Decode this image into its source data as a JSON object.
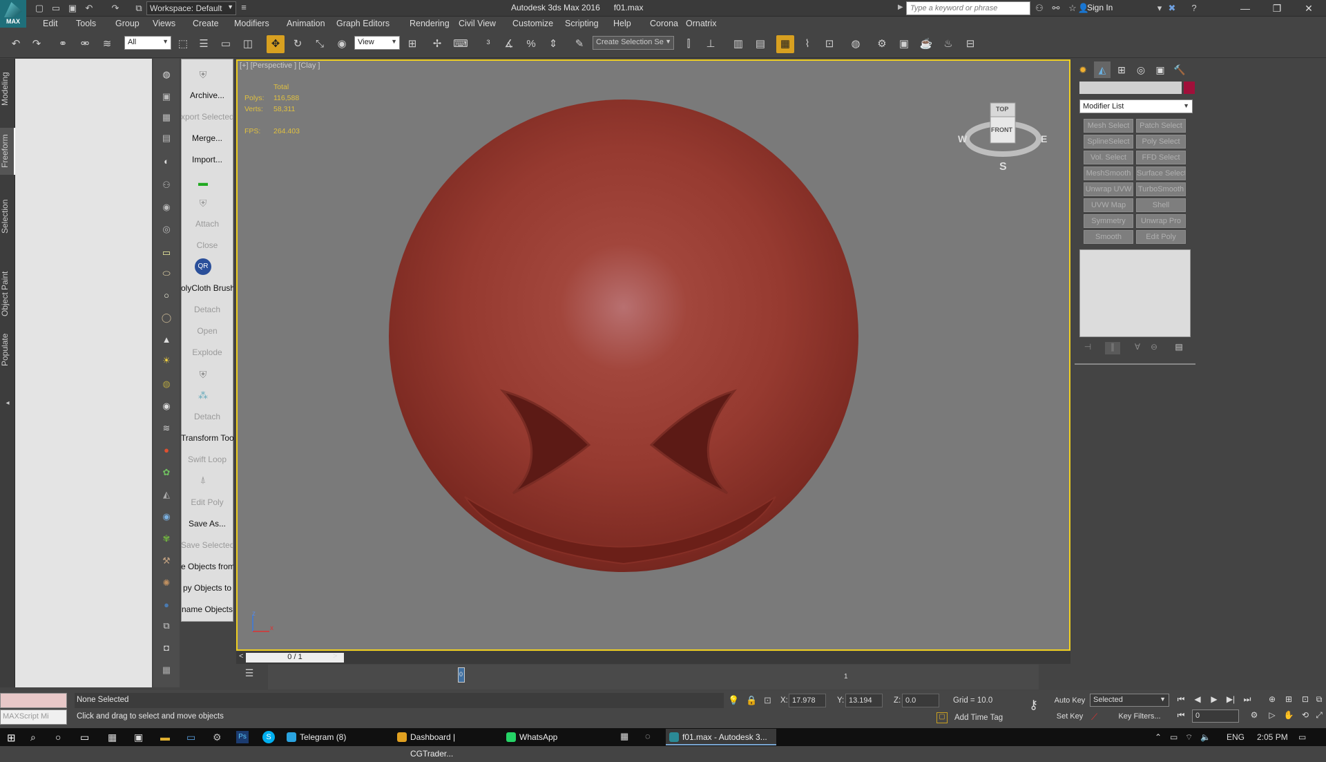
{
  "titlebar": {
    "app_logo_text": "MAX",
    "workspace": "Workspace: Default",
    "title": "Autodesk 3ds Max 2016      f01.max",
    "search_placeholder": "Type a keyword or phrase",
    "sign_in": "Sign In"
  },
  "menu": [
    "Edit",
    "Tools",
    "Group",
    "Views",
    "Create",
    "Modifiers",
    "Animation",
    "Graph Editors",
    "Rendering",
    "Civil View",
    "Customize",
    "Scripting",
    "Help",
    "Corona",
    "Ornatrix"
  ],
  "toolbar": {
    "filter_value": "All",
    "refcoord_value": "View",
    "selection_set_placeholder": "Create Selection Se"
  },
  "ribbon_tabs": [
    "Modeling",
    "Freeform",
    "Selection",
    "Object Paint",
    "Populate"
  ],
  "command_column": [
    {
      "label": "Archive...",
      "dim": false
    },
    {
      "label": "xport Selected",
      "dim": true
    },
    {
      "label": "Merge...",
      "dim": false
    },
    {
      "label": "Import...",
      "dim": false
    },
    {
      "label": "Attach",
      "dim": true
    },
    {
      "label": "Close",
      "dim": true
    },
    {
      "label": "olyCloth Brush",
      "dim": false
    },
    {
      "label": "Detach",
      "dim": true
    },
    {
      "label": "Open",
      "dim": true
    },
    {
      "label": "Explode",
      "dim": true
    },
    {
      "label": "Detach",
      "dim": true
    },
    {
      "label": "Transform Tool",
      "dim": false
    },
    {
      "label": "Swift Loop",
      "dim": true
    },
    {
      "label": "Edit Poly",
      "dim": true
    },
    {
      "label": "Save As...",
      "dim": false
    },
    {
      "label": "Save Selected",
      "dim": true
    },
    {
      "label": "e Objects from",
      "dim": false
    },
    {
      "label": "py Objects to",
      "dim": false
    },
    {
      "label": "name Objects",
      "dim": false
    }
  ],
  "viewport": {
    "label": "[+] [Perspective ] [Clay ]",
    "stats": {
      "total_label": "Total",
      "polys_label": "Polys:",
      "polys": "116,588",
      "verts_label": "Verts:",
      "verts": "58,311",
      "fps_label": "FPS:",
      "fps": "264.403"
    },
    "viewcube": {
      "top": "TOP",
      "front": "FRONT",
      "south": "S",
      "west": "W",
      "east": "E"
    },
    "axis_z": "z",
    "axis_x": "x"
  },
  "timeline": {
    "frame_display": "0 / 1",
    "prev": "<",
    "next": ">",
    "track_tick": "0",
    "track_tick2": "1",
    "time_value": 0.0
  },
  "command_panel": {
    "modifier_list": "Modifier List",
    "object_color": "#a0103a",
    "modifier_buttons": [
      "Mesh Select",
      "Patch Select",
      "SplineSelect",
      "Poly Select",
      "Vol. Select",
      "FFD Select",
      "MeshSmooth",
      "Surface Select",
      "Unwrap UVW",
      "TurboSmooth",
      "UVW Map",
      "Shell",
      "Symmetry",
      "Unwrap Pro",
      "Smooth",
      "Edit Poly"
    ]
  },
  "status": {
    "maxscript_placeholder": "MAXScript Mi",
    "selection": "None Selected",
    "prompt": "Click and drag to select and move objects",
    "x_label": "X:",
    "x": "17.978",
    "y_label": "Y:",
    "y": "13.194",
    "z_label": "Z:",
    "z": "0.0",
    "grid": "Grid = 10.0",
    "add_time_tag": "Add Time Tag",
    "auto_key": "Auto Key",
    "set_key": "Set Key",
    "selected_combo": "Selected",
    "key_filters": "Key Filters...",
    "frame_field": "0"
  },
  "taskbar": {
    "items": [
      {
        "label": "Telegram (8)",
        "color": "#2aa3df"
      },
      {
        "label": "Dashboard | CGTrader...",
        "color": "#e0a020"
      },
      {
        "label": "WhatsApp",
        "color": "#25d366"
      },
      {
        "label": "f01.max - Autodesk 3...",
        "color": "#2b8a96"
      }
    ],
    "lang": "ENG",
    "time": "2:05 PM"
  }
}
